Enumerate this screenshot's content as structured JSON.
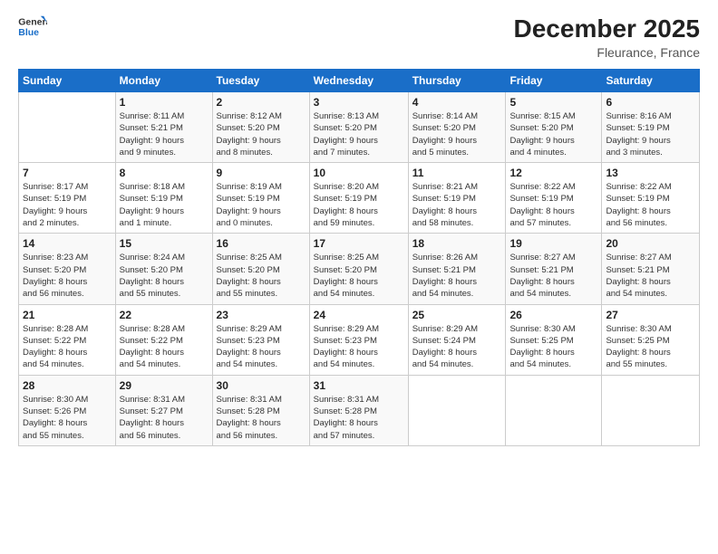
{
  "logo": {
    "line1": "General",
    "line2": "Blue"
  },
  "title": "December 2025",
  "subtitle": "Fleurance, France",
  "days_header": [
    "Sunday",
    "Monday",
    "Tuesday",
    "Wednesday",
    "Thursday",
    "Friday",
    "Saturday"
  ],
  "weeks": [
    [
      {
        "day": "",
        "info": ""
      },
      {
        "day": "1",
        "info": "Sunrise: 8:11 AM\nSunset: 5:21 PM\nDaylight: 9 hours\nand 9 minutes."
      },
      {
        "day": "2",
        "info": "Sunrise: 8:12 AM\nSunset: 5:20 PM\nDaylight: 9 hours\nand 8 minutes."
      },
      {
        "day": "3",
        "info": "Sunrise: 8:13 AM\nSunset: 5:20 PM\nDaylight: 9 hours\nand 7 minutes."
      },
      {
        "day": "4",
        "info": "Sunrise: 8:14 AM\nSunset: 5:20 PM\nDaylight: 9 hours\nand 5 minutes."
      },
      {
        "day": "5",
        "info": "Sunrise: 8:15 AM\nSunset: 5:20 PM\nDaylight: 9 hours\nand 4 minutes."
      },
      {
        "day": "6",
        "info": "Sunrise: 8:16 AM\nSunset: 5:19 PM\nDaylight: 9 hours\nand 3 minutes."
      }
    ],
    [
      {
        "day": "7",
        "info": "Sunrise: 8:17 AM\nSunset: 5:19 PM\nDaylight: 9 hours\nand 2 minutes."
      },
      {
        "day": "8",
        "info": "Sunrise: 8:18 AM\nSunset: 5:19 PM\nDaylight: 9 hours\nand 1 minute."
      },
      {
        "day": "9",
        "info": "Sunrise: 8:19 AM\nSunset: 5:19 PM\nDaylight: 9 hours\nand 0 minutes."
      },
      {
        "day": "10",
        "info": "Sunrise: 8:20 AM\nSunset: 5:19 PM\nDaylight: 8 hours\nand 59 minutes."
      },
      {
        "day": "11",
        "info": "Sunrise: 8:21 AM\nSunset: 5:19 PM\nDaylight: 8 hours\nand 58 minutes."
      },
      {
        "day": "12",
        "info": "Sunrise: 8:22 AM\nSunset: 5:19 PM\nDaylight: 8 hours\nand 57 minutes."
      },
      {
        "day": "13",
        "info": "Sunrise: 8:22 AM\nSunset: 5:19 PM\nDaylight: 8 hours\nand 56 minutes."
      }
    ],
    [
      {
        "day": "14",
        "info": "Sunrise: 8:23 AM\nSunset: 5:20 PM\nDaylight: 8 hours\nand 56 minutes."
      },
      {
        "day": "15",
        "info": "Sunrise: 8:24 AM\nSunset: 5:20 PM\nDaylight: 8 hours\nand 55 minutes."
      },
      {
        "day": "16",
        "info": "Sunrise: 8:25 AM\nSunset: 5:20 PM\nDaylight: 8 hours\nand 55 minutes."
      },
      {
        "day": "17",
        "info": "Sunrise: 8:25 AM\nSunset: 5:20 PM\nDaylight: 8 hours\nand 54 minutes."
      },
      {
        "day": "18",
        "info": "Sunrise: 8:26 AM\nSunset: 5:21 PM\nDaylight: 8 hours\nand 54 minutes."
      },
      {
        "day": "19",
        "info": "Sunrise: 8:27 AM\nSunset: 5:21 PM\nDaylight: 8 hours\nand 54 minutes."
      },
      {
        "day": "20",
        "info": "Sunrise: 8:27 AM\nSunset: 5:21 PM\nDaylight: 8 hours\nand 54 minutes."
      }
    ],
    [
      {
        "day": "21",
        "info": "Sunrise: 8:28 AM\nSunset: 5:22 PM\nDaylight: 8 hours\nand 54 minutes."
      },
      {
        "day": "22",
        "info": "Sunrise: 8:28 AM\nSunset: 5:22 PM\nDaylight: 8 hours\nand 54 minutes."
      },
      {
        "day": "23",
        "info": "Sunrise: 8:29 AM\nSunset: 5:23 PM\nDaylight: 8 hours\nand 54 minutes."
      },
      {
        "day": "24",
        "info": "Sunrise: 8:29 AM\nSunset: 5:23 PM\nDaylight: 8 hours\nand 54 minutes."
      },
      {
        "day": "25",
        "info": "Sunrise: 8:29 AM\nSunset: 5:24 PM\nDaylight: 8 hours\nand 54 minutes."
      },
      {
        "day": "26",
        "info": "Sunrise: 8:30 AM\nSunset: 5:25 PM\nDaylight: 8 hours\nand 54 minutes."
      },
      {
        "day": "27",
        "info": "Sunrise: 8:30 AM\nSunset: 5:25 PM\nDaylight: 8 hours\nand 55 minutes."
      }
    ],
    [
      {
        "day": "28",
        "info": "Sunrise: 8:30 AM\nSunset: 5:26 PM\nDaylight: 8 hours\nand 55 minutes."
      },
      {
        "day": "29",
        "info": "Sunrise: 8:31 AM\nSunset: 5:27 PM\nDaylight: 8 hours\nand 56 minutes."
      },
      {
        "day": "30",
        "info": "Sunrise: 8:31 AM\nSunset: 5:28 PM\nDaylight: 8 hours\nand 56 minutes."
      },
      {
        "day": "31",
        "info": "Sunrise: 8:31 AM\nSunset: 5:28 PM\nDaylight: 8 hours\nand 57 minutes."
      },
      {
        "day": "",
        "info": ""
      },
      {
        "day": "",
        "info": ""
      },
      {
        "day": "",
        "info": ""
      }
    ]
  ]
}
